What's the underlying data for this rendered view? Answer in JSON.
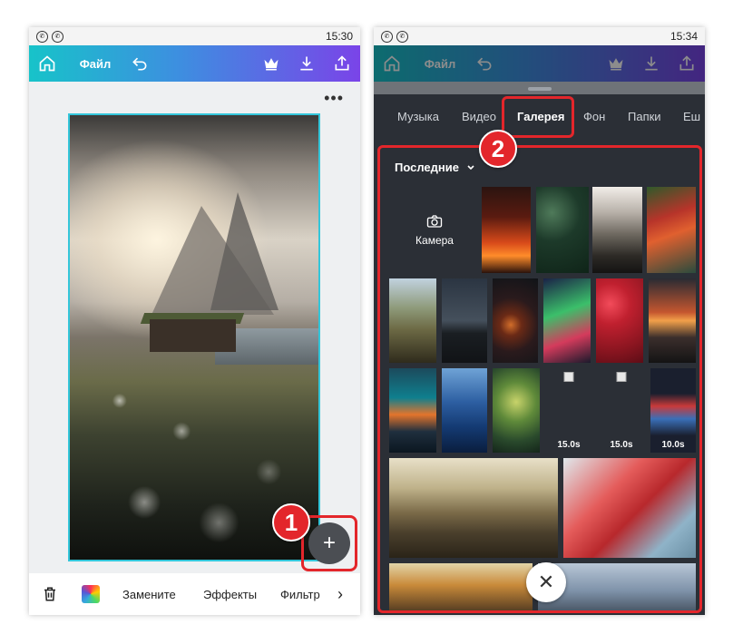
{
  "status_bar": {
    "left_phone_time": "15:30",
    "right_phone_time": "15:34"
  },
  "app_bar": {
    "file_label": "Файл"
  },
  "left_phone": {
    "bottom_bar": {
      "replace_label": "Замените",
      "effects_label": "Эффекты",
      "filter_label": "Фильтр"
    }
  },
  "right_phone": {
    "tabs": [
      {
        "label": "Музыка"
      },
      {
        "label": "Видео"
      },
      {
        "label": "Галерея",
        "active": true
      },
      {
        "label": "Фон"
      },
      {
        "label": "Папки"
      },
      {
        "label": "Еш"
      }
    ],
    "gallery": {
      "filter_label": "Последние",
      "camera_label": "Камера",
      "video_durations": [
        "15.0s",
        "15.0s",
        "10.0s"
      ]
    }
  },
  "annotations": {
    "step_1": "1",
    "step_2": "2"
  },
  "colors": {
    "highlight": "#e3262b",
    "canvas_border": "#33c6da",
    "panel_bg": "#2b2f36"
  },
  "icons": [
    "home-icon",
    "undo-icon",
    "crown-icon",
    "download-icon",
    "share-icon",
    "more-dots-icon",
    "plus-icon",
    "trash-icon",
    "color-icon",
    "chevron-right-icon",
    "chevron-down-icon",
    "camera-icon",
    "close-icon"
  ]
}
